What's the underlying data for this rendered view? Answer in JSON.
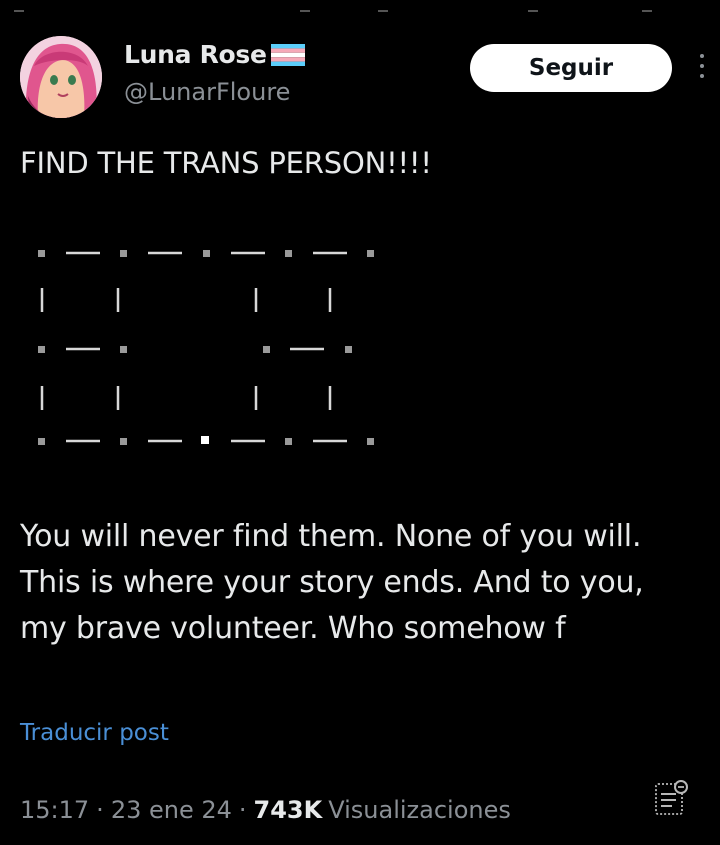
{
  "user": {
    "name": "Luna Rose",
    "handle": "@LunarFloure",
    "flag_icon": "trans-flag-icon",
    "follow_label": "Seguir"
  },
  "post": {
    "headline": "FIND THE TRANS PERSON!!!!",
    "body": "You will never find them. None of you will. This is where your story ends. And to you, my brave volunteer. Who somehow f",
    "translate_label": "Traducir post"
  },
  "meta": {
    "time": "15:17",
    "separator": "·",
    "date": "23 ene 24",
    "views_count": "743K",
    "views_label": "Visualizaciones"
  },
  "colors": {
    "background": "#000000",
    "text": "#e7e9ea",
    "muted": "#8b9096",
    "link": "#4a8fd6",
    "flag_blue": "#5bcefa",
    "flag_pink": "#f5a9b8",
    "flag_white": "#ffffff"
  }
}
